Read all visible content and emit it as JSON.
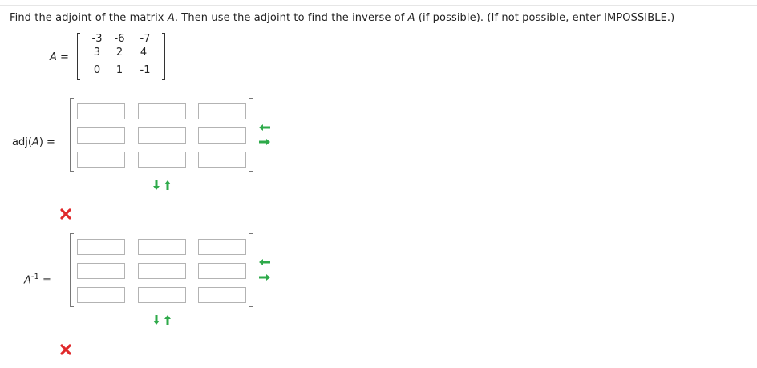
{
  "question": {
    "part1": "Find the adjoint of the matrix ",
    "var": "A",
    "part2": ". Then use the adjoint to find the inverse of ",
    "var2": "A",
    "part3": " (if possible). (If not possible, enter IMPOSSIBLE.)"
  },
  "matrix_a": {
    "label_var": "A",
    "label_eq": " =",
    "rows": [
      [
        "-3",
        "-6",
        "-7"
      ],
      [
        "3",
        "2",
        "4"
      ],
      [
        "0",
        "1",
        "-1"
      ]
    ]
  },
  "adj": {
    "label_pre": "adj(",
    "label_var": "A",
    "label_post": ") =",
    "values": [
      [
        "",
        "",
        ""
      ],
      [
        "",
        "",
        ""
      ],
      [
        "",
        "",
        ""
      ]
    ]
  },
  "inverse": {
    "label_var": "A",
    "label_sup": "-1",
    "label_eq": " =",
    "values": [
      [
        "",
        "",
        ""
      ],
      [
        "",
        "",
        ""
      ],
      [
        "",
        "",
        ""
      ]
    ]
  },
  "colors": {
    "arrow_green": "#2eaa4a",
    "incorrect_red": "#e0292b"
  },
  "icons": {
    "add_column": "arrow-left-icon",
    "remove_column": "arrow-right-icon",
    "add_row": "arrow-down-icon",
    "remove_row": "arrow-up-icon",
    "incorrect": "x-mark-icon"
  }
}
